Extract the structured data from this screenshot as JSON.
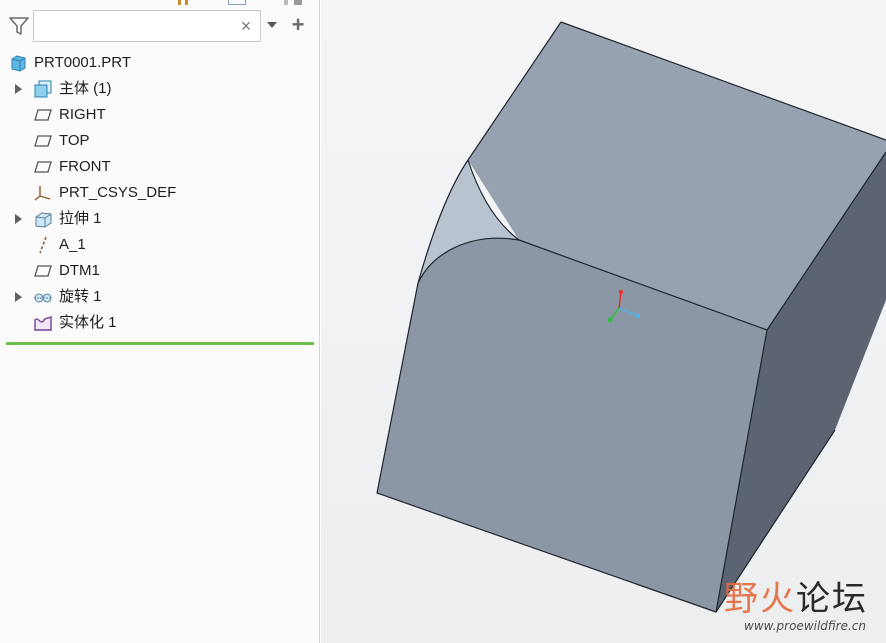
{
  "filter": {
    "search_value": "",
    "search_placeholder": "",
    "clear_glyph": "×",
    "add_glyph": "+"
  },
  "model_tree": [
    {
      "label": "PRT0001.PRT",
      "icon": "part-icon",
      "expandable": false,
      "indent": 0
    },
    {
      "label": "主体 (1)",
      "icon": "body-icon",
      "expandable": true,
      "indent": 1
    },
    {
      "label": "RIGHT",
      "icon": "datum-plane-icon",
      "expandable": false,
      "indent": 1
    },
    {
      "label": "TOP",
      "icon": "datum-plane-icon",
      "expandable": false,
      "indent": 1
    },
    {
      "label": "FRONT",
      "icon": "datum-plane-icon",
      "expandable": false,
      "indent": 1
    },
    {
      "label": "PRT_CSYS_DEF",
      "icon": "coordinate-system-icon",
      "expandable": false,
      "indent": 1
    },
    {
      "label": "拉伸 1",
      "icon": "extrude-icon",
      "expandable": true,
      "indent": 1
    },
    {
      "label": "A_1",
      "icon": "datum-axis-icon",
      "expandable": false,
      "indent": 1
    },
    {
      "label": "DTM1",
      "icon": "datum-plane-icon",
      "expandable": false,
      "indent": 1
    },
    {
      "label": "旋转 1",
      "icon": "revolve-icon",
      "expandable": true,
      "indent": 1
    },
    {
      "label": "实体化 1",
      "icon": "solidify-icon",
      "expandable": false,
      "indent": 1
    }
  ],
  "watermark": {
    "part1": "野火",
    "part2": "论坛",
    "url": "www.proewildfire.cn"
  },
  "colors": {
    "insert_line": "#6cc24a",
    "face_top": "#97a2b0",
    "face_front": "#8c97a6",
    "face_right": "#5b6470",
    "fillet_face": "#b8c3d0",
    "axis_x": "#4fb0e8",
    "axis_y": "#e03030",
    "axis_z": "#30c040"
  }
}
